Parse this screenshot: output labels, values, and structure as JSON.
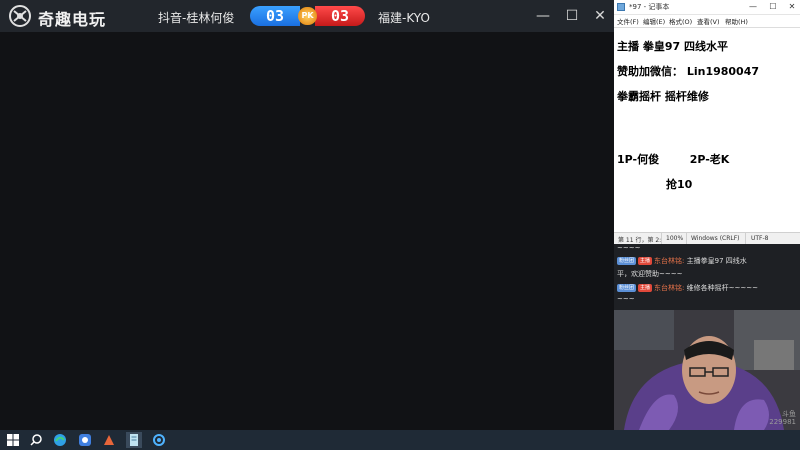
{
  "app": {
    "brand": "奇趣电玩",
    "player1": "抖音-桂林何俊",
    "player2": "福建-KYO",
    "score1": "03",
    "score2": "03",
    "pk_label": "PK",
    "controls": {
      "minimize": "—",
      "maximize": "☐",
      "close": "✕"
    }
  },
  "notepad": {
    "title": "*97 - 记事本",
    "menu": [
      "文件(F)",
      "编辑(E)",
      "格式(O)",
      "查看(V)",
      "帮助(H)"
    ],
    "lines": [
      "主播 拳皇97 四线水平",
      "赞助加微信： Lin1980047",
      "拳霸摇杆  摇杆维修",
      "1P-何俊        2P-老K",
      "抢10"
    ],
    "status": {
      "position": "第 11 行，第 2:",
      "zoom": "100%",
      "line_ending": "Windows (CRLF)",
      "encoding": "UTF-8"
    }
  },
  "chat": {
    "lines": [
      {
        "text": "~~~~"
      },
      {
        "badge1": "粉丝团",
        "badge2": "主播",
        "user": "东台林铭:",
        "msg": "主播拳皇97 四线水"
      },
      {
        "text": "平，欢迎赞助~~~~"
      },
      {
        "badge1": "粉丝团",
        "badge2": "主播",
        "user": "东台林铭:",
        "msg": "维修各种摇杆~~~~~"
      },
      {
        "text": "~~~"
      }
    ]
  },
  "watermark": {
    "line1": "斗鱼",
    "line2": "229981"
  },
  "colors": {
    "score_blue": "#1a6fe0",
    "score_red": "#c61a1a",
    "username": "#e8734a"
  }
}
